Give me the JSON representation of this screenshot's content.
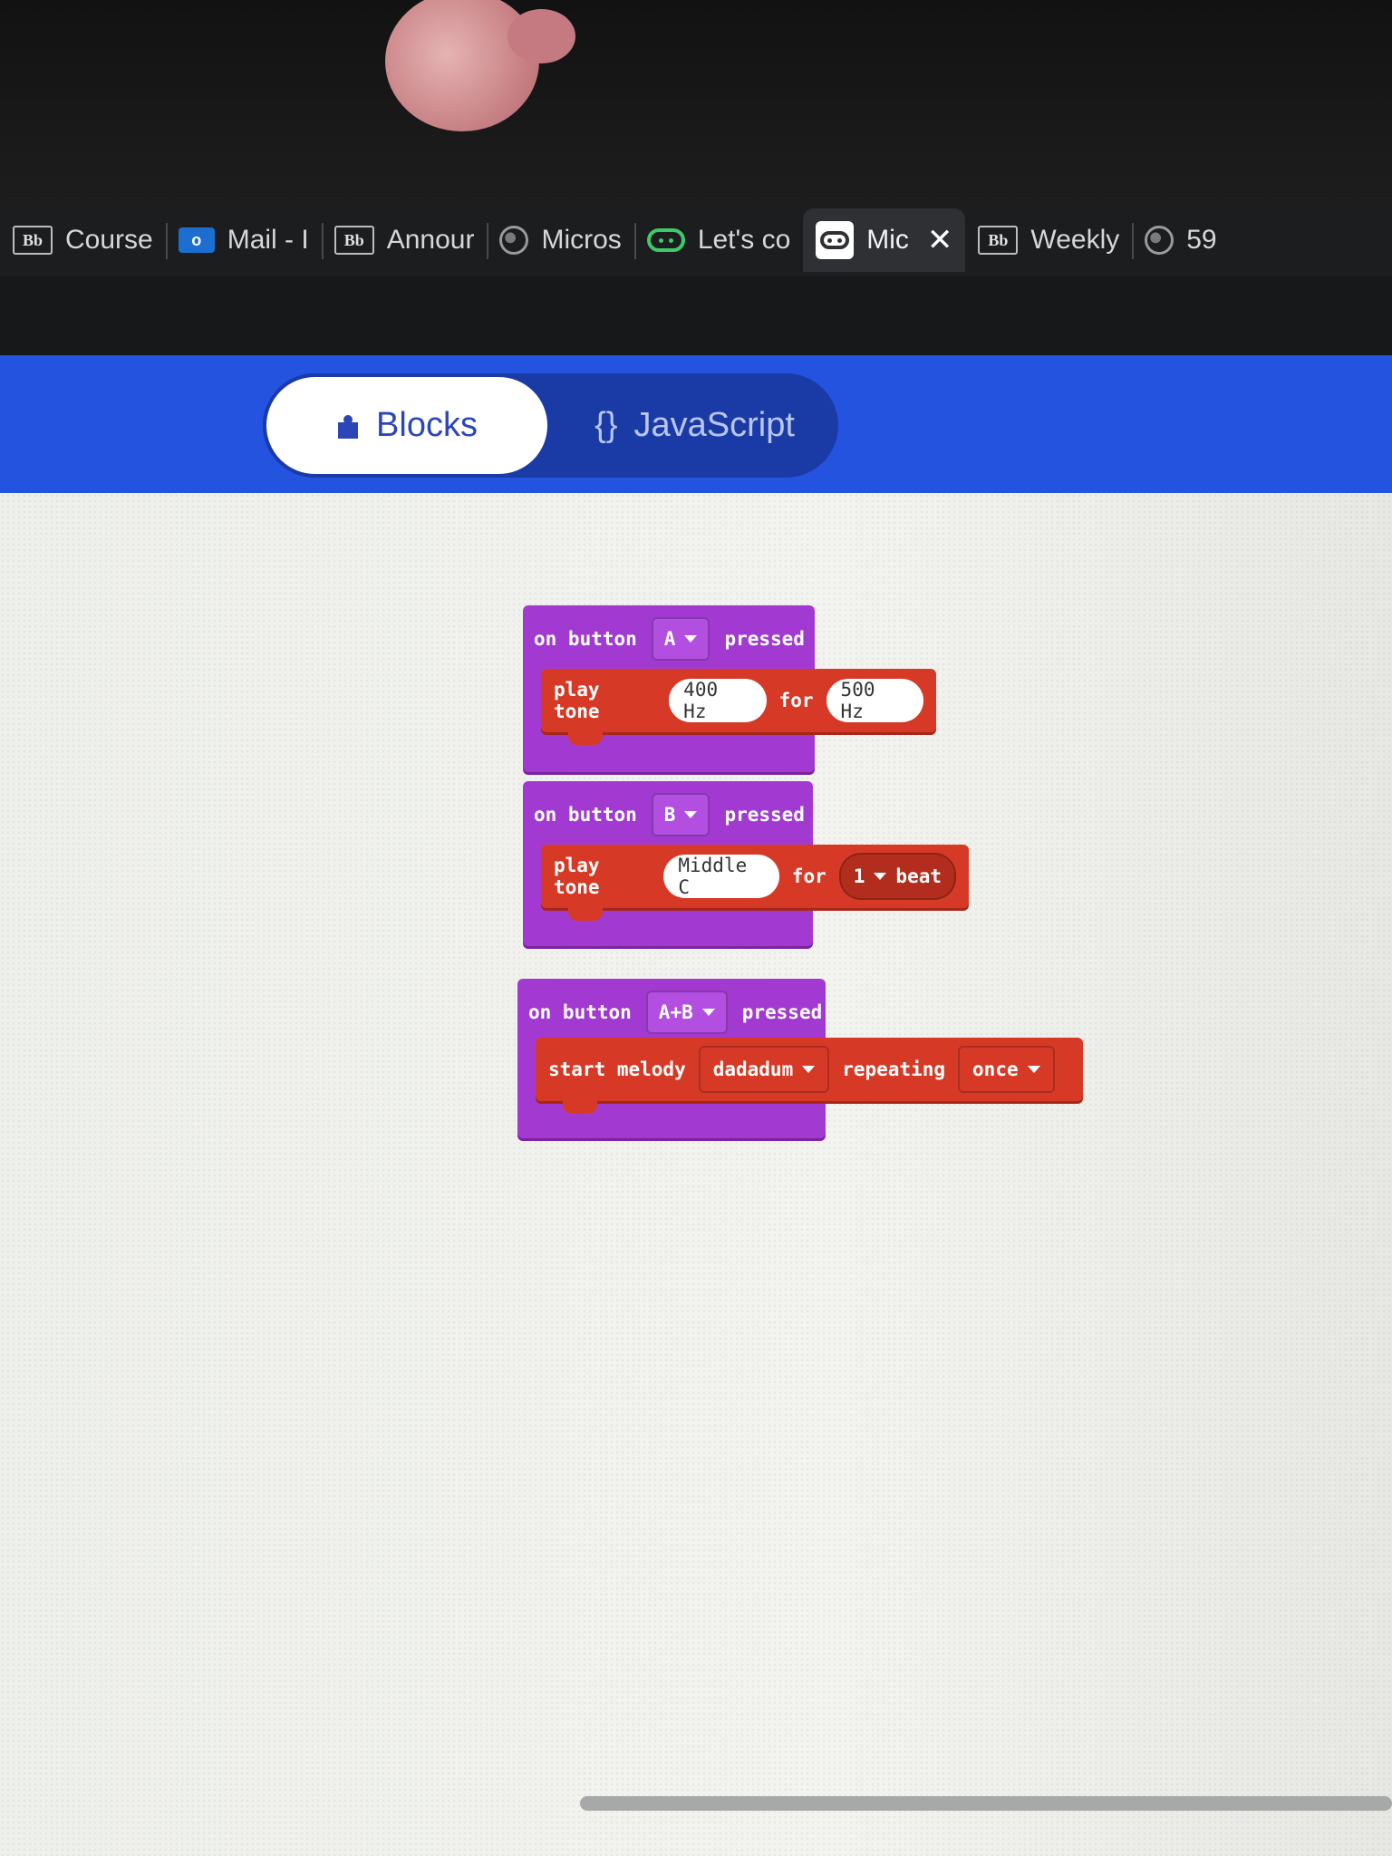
{
  "browser": {
    "tabs": [
      {
        "icon": "blackboard-icon",
        "fav": "Bb",
        "label": "Course"
      },
      {
        "icon": "outlook-icon",
        "fav": "o",
        "label": "Mail - I"
      },
      {
        "icon": "blackboard-icon",
        "fav": "Bb",
        "label": "Annour"
      },
      {
        "icon": "globe-icon",
        "fav": "",
        "label": "Micros"
      },
      {
        "icon": "microbit-icon",
        "fav": "",
        "label": "Let's co"
      },
      {
        "icon": "microbit-icon",
        "fav": "",
        "label": "Mic",
        "active": true
      },
      {
        "icon": "blackboard-icon",
        "fav": "Bb",
        "label": "Weekly"
      },
      {
        "icon": "globe-icon",
        "fav": "",
        "label": "59"
      }
    ]
  },
  "editor": {
    "blocks_label": "Blocks",
    "js_icon": "{}",
    "js_label": "JavaScript",
    "active_mode": "Blocks",
    "accent": "#2453e0"
  },
  "program": {
    "event_color": "#a23ad1",
    "statement_color": "#d63a26",
    "handlers": [
      {
        "prefix": "on button",
        "button": "A",
        "suffix": "pressed",
        "statement": {
          "kw1": "play tone",
          "arg1": "400 Hz",
          "kw2": "for",
          "arg2": "500 Hz"
        }
      },
      {
        "prefix": "on button",
        "button": "B",
        "suffix": "pressed",
        "statement": {
          "kw1": "play tone",
          "arg1": "Middle C",
          "kw2": "for",
          "arg2": "1",
          "kw3": "beat"
        }
      },
      {
        "prefix": "on button",
        "button": "A+B",
        "suffix": "pressed",
        "statement": {
          "kw1": "start melody",
          "arg1": "dadadum",
          "kw2": "repeating",
          "arg2": "once"
        }
      }
    ]
  }
}
